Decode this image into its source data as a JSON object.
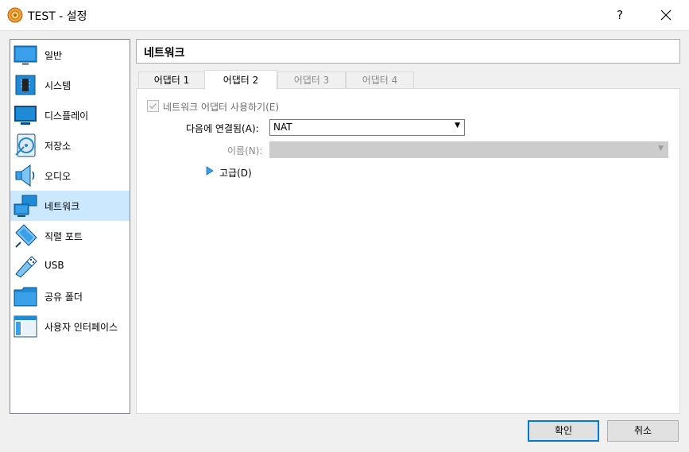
{
  "window": {
    "title": "TEST - 설정",
    "help_label": "?"
  },
  "sidebar": {
    "items": [
      {
        "label": "일반",
        "icon": "general-icon"
      },
      {
        "label": "시스템",
        "icon": "system-icon"
      },
      {
        "label": "디스플레이",
        "icon": "display-icon"
      },
      {
        "label": "저장소",
        "icon": "storage-icon"
      },
      {
        "label": "오디오",
        "icon": "audio-icon"
      },
      {
        "label": "네트워크",
        "icon": "network-icon",
        "selected": true
      },
      {
        "label": "직렬 포트",
        "icon": "serial-port-icon"
      },
      {
        "label": "USB",
        "icon": "usb-icon"
      },
      {
        "label": "공유 폴더",
        "icon": "shared-folder-icon"
      },
      {
        "label": "사용자 인터페이스",
        "icon": "user-interface-icon"
      }
    ]
  },
  "main": {
    "page_title": "네트워크",
    "tabs": [
      {
        "label": "어댑터 1",
        "state": "enabled"
      },
      {
        "label": "어댑터 2",
        "state": "active"
      },
      {
        "label": "어댑터 3",
        "state": "disabled"
      },
      {
        "label": "어댑터 4",
        "state": "disabled"
      }
    ],
    "enable_adapter_label": "네트워크 어댑터 사용하기(E)",
    "enable_adapter_checked": true,
    "attached_to_label": "다음에 연결됨(A):",
    "attached_to_value": "NAT",
    "name_label": "이름(N):",
    "name_value": "",
    "advanced_label": "고급(D)"
  },
  "buttons": {
    "ok_label": "확인",
    "cancel_label": "취소"
  },
  "colors": {
    "selection_bg": "#cce8ff",
    "accent": "#0078d7",
    "icon_blue": "#1f8ad6"
  }
}
